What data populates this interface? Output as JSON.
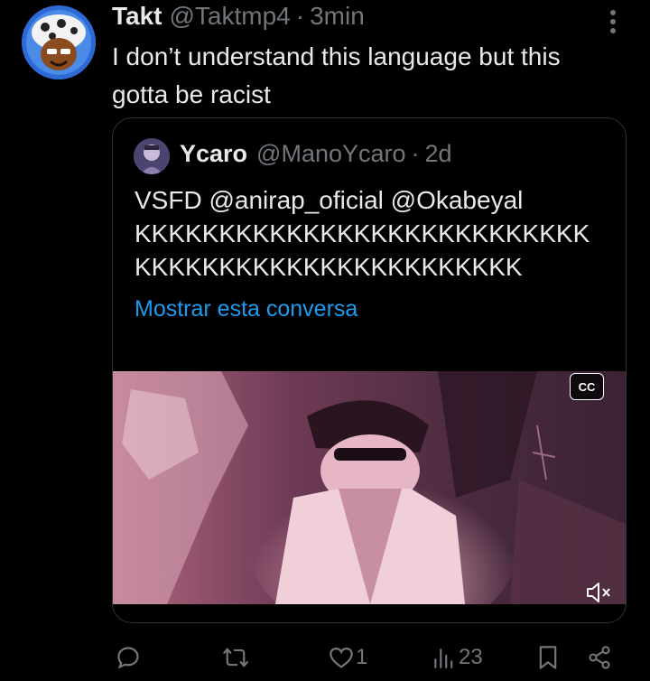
{
  "tweet": {
    "author_name": "Takt",
    "author_handle": "@Taktmp4",
    "separator": "·",
    "time": "3min",
    "text_lines": [
      "I don’t understand this language but this",
      "gotta be racist"
    ]
  },
  "quoted_tweet": {
    "author_name": "Ycaro",
    "author_handle": "@ManoYcaro",
    "separator": "·",
    "time": "2d",
    "text_lines": [
      "VSFD @anirap_oficial @Okabeyal",
      "KKKKKKKKKKKKKKKKKKKKKKKKKKK",
      "KKKKKKKKKKKKKKKKKKKKKKK"
    ],
    "show_thread_link": "Mostrar esta conversa",
    "video": {
      "captions_label": "CC"
    }
  },
  "actions": {
    "reply_count": "",
    "retweet_count": "",
    "like_count": "1",
    "views_count": "23"
  },
  "colors": {
    "background": "#000000",
    "text": "#e7e9ea",
    "secondary_text": "#71767b",
    "link": "#1d9bf0",
    "border": "#2f3336"
  },
  "icons": [
    "more-icon",
    "reply-icon",
    "retweet-icon",
    "like-icon",
    "views-icon",
    "bookmark-icon",
    "share-icon",
    "mute-icon",
    "captions-icon"
  ]
}
